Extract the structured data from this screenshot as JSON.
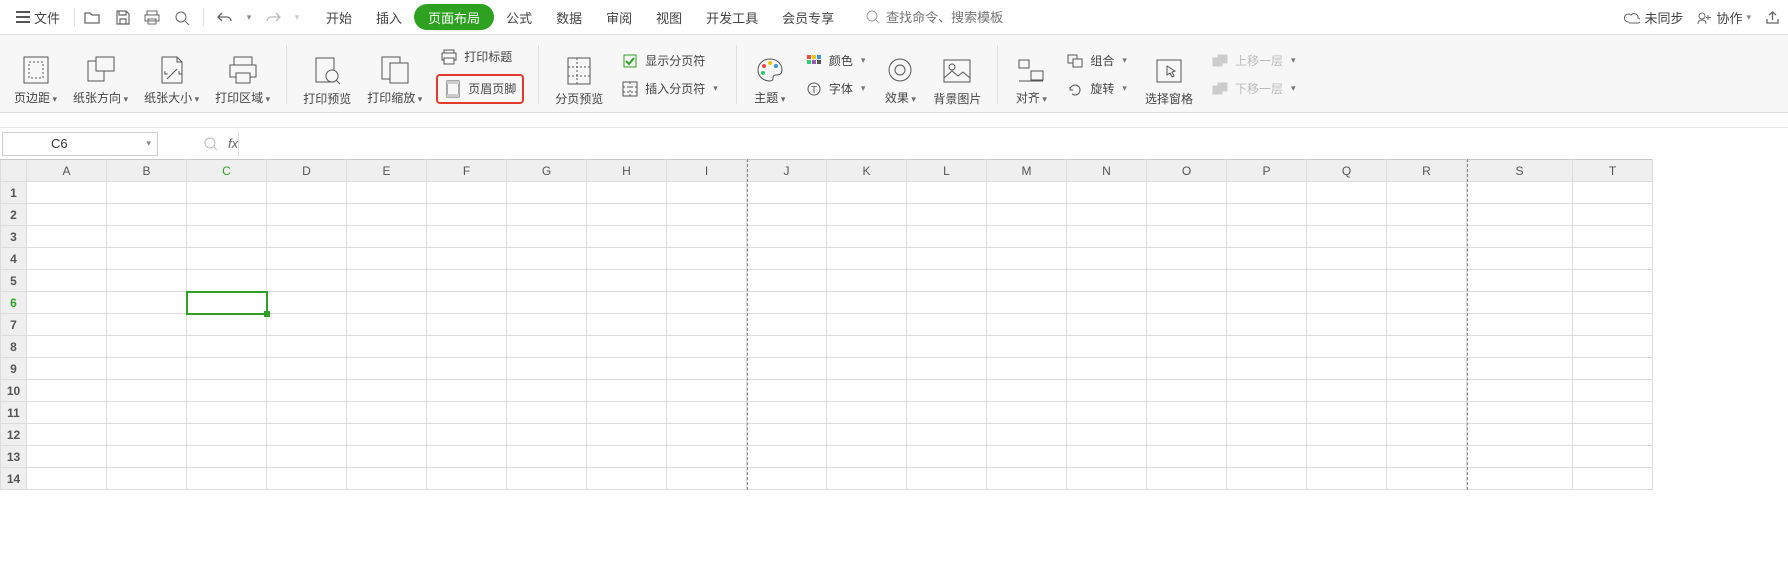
{
  "titlebar": {
    "file_label": "文件",
    "search_placeholder": "查找命令、搜索模板",
    "unsynced": "未同步",
    "collab": "协作"
  },
  "menu": {
    "start": "开始",
    "insert": "插入",
    "layout": "页面布局",
    "formula": "公式",
    "data": "数据",
    "review": "审阅",
    "view": "视图",
    "dev": "开发工具",
    "vip": "会员专享"
  },
  "ribbon": {
    "margins": "页边距",
    "orientation": "纸张方向",
    "size": "纸张大小",
    "print_area": "打印区域",
    "print_preview": "打印预览",
    "print_scale": "打印缩放",
    "print_title": "打印标题",
    "header_footer": "页眉页脚",
    "page_preview": "分页预览",
    "show_breaks": "显示分页符",
    "insert_break": "插入分页符",
    "theme": "主题",
    "color": "颜色",
    "font": "字体",
    "effects": "效果",
    "bg_image": "背景图片",
    "align": "对齐",
    "group": "组合",
    "rotate": "旋转",
    "selection_pane": "选择窗格",
    "bring_forward": "上移一层",
    "send_backward": "下移一层"
  },
  "formula_bar": {
    "cell_ref": "C6",
    "fx": "fx"
  },
  "columns": [
    "A",
    "B",
    "C",
    "D",
    "E",
    "F",
    "G",
    "H",
    "I",
    "J",
    "K",
    "L",
    "M",
    "N",
    "O",
    "P",
    "Q",
    "R",
    "S",
    "T"
  ],
  "rows": [
    "1",
    "2",
    "3",
    "4",
    "5",
    "6",
    "7",
    "8",
    "9",
    "10",
    "11",
    "12",
    "13",
    "14"
  ],
  "active": {
    "col": "C",
    "row": "6"
  },
  "page_breaks_after_cols": [
    "I",
    "R"
  ]
}
